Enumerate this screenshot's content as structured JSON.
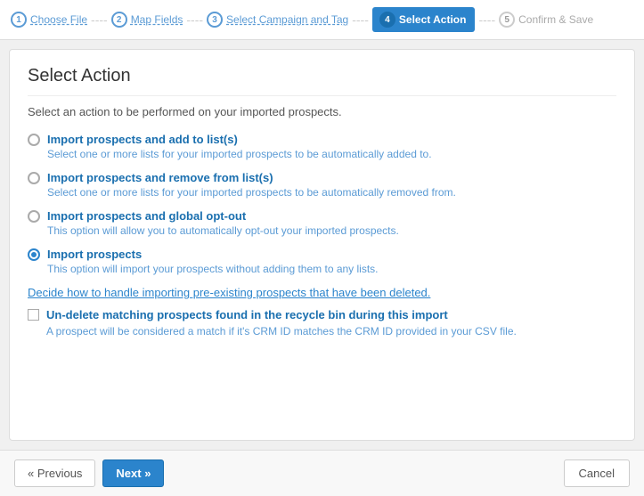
{
  "wizard": {
    "steps": [
      {
        "id": "step1",
        "num": "1",
        "label": "Choose File",
        "state": "completed"
      },
      {
        "id": "step2",
        "num": "2",
        "label": "Map Fields",
        "state": "completed"
      },
      {
        "id": "step3",
        "num": "3",
        "label": "Select Campaign and Tag",
        "state": "completed"
      },
      {
        "id": "step4",
        "num": "4",
        "label": "Select Action",
        "state": "active"
      },
      {
        "id": "step5",
        "num": "5",
        "label": "Confirm & Save",
        "state": "inactive"
      }
    ]
  },
  "page": {
    "title": "Select Action",
    "intro": "Select an action to be performed on your imported prospects."
  },
  "options": [
    {
      "id": "opt1",
      "selected": false,
      "label": "Import prospects and add to list(s)",
      "desc": "Select one or more lists for your imported prospects to be automatically added to."
    },
    {
      "id": "opt2",
      "selected": false,
      "label": "Import prospects and remove from list(s)",
      "desc": "Select one or more lists for your imported prospects to be automatically removed from."
    },
    {
      "id": "opt3",
      "selected": false,
      "label": "Import prospects and global opt-out",
      "desc": "This option will allow you to automatically opt-out your imported prospects."
    },
    {
      "id": "opt4",
      "selected": true,
      "label": "Import prospects",
      "desc": "This option will import your prospects without adding them to any lists."
    }
  ],
  "deleted_section": {
    "link_text": "Decide how to handle importing pre-existing prospects that have been deleted."
  },
  "checkbox_item": {
    "label": "Un-delete matching prospects found in the recycle bin during this import",
    "desc": "A prospect will be considered a match if it's CRM ID matches the CRM ID provided in your CSV file."
  },
  "footer": {
    "prev_label": "« Previous",
    "next_label": "Next »",
    "cancel_label": "Cancel"
  }
}
